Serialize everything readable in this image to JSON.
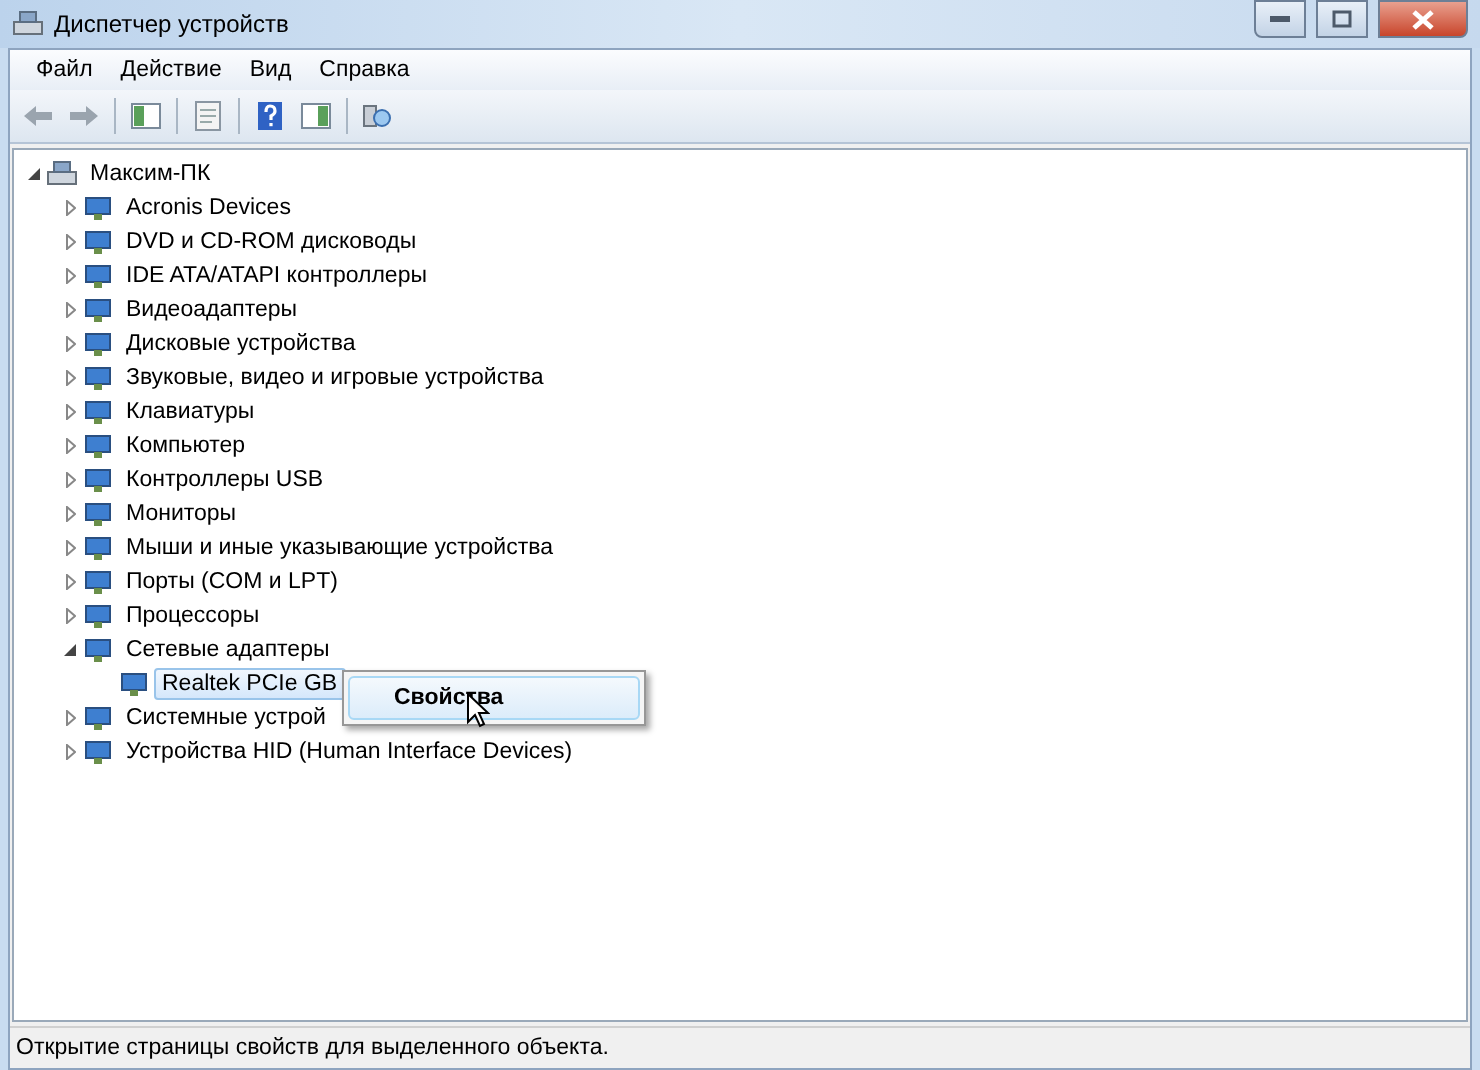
{
  "window": {
    "title": "Диспетчер устройств"
  },
  "menu": [
    "Файл",
    "Действие",
    "Вид",
    "Справка"
  ],
  "tree": {
    "label": "Максим-ПК",
    "expanded": true,
    "selected": false,
    "children": [
      {
        "label": "Acronis Devices",
        "expanded": false,
        "selected": false
      },
      {
        "label": "DVD и CD-ROM дисководы",
        "expanded": false,
        "selected": false
      },
      {
        "label": "IDE ATA/ATAPI контроллеры",
        "expanded": false,
        "selected": false
      },
      {
        "label": "Видеоадаптеры",
        "expanded": false,
        "selected": false
      },
      {
        "label": "Дисковые устройства",
        "expanded": false,
        "selected": false
      },
      {
        "label": "Звуковые, видео и игровые устройства",
        "expanded": false,
        "selected": false
      },
      {
        "label": "Клавиатуры",
        "expanded": false,
        "selected": false
      },
      {
        "label": "Компьютер",
        "expanded": false,
        "selected": false
      },
      {
        "label": "Контроллеры USB",
        "expanded": false,
        "selected": false
      },
      {
        "label": "Мониторы",
        "expanded": false,
        "selected": false
      },
      {
        "label": "Мыши и иные указывающие устройства",
        "expanded": false,
        "selected": false
      },
      {
        "label": "Порты (COM и LPT)",
        "expanded": false,
        "selected": false
      },
      {
        "label": "Процессоры",
        "expanded": false,
        "selected": false
      },
      {
        "label": "Сетевые адаптеры",
        "expanded": true,
        "selected": false,
        "children": [
          {
            "label": "Realtek PCIe GB",
            "selected": true
          }
        ]
      },
      {
        "label": "Системные устрой",
        "expanded": false,
        "selected": false
      },
      {
        "label": "Устройства HID (Human Interface Devices)",
        "expanded": false,
        "selected": false
      }
    ]
  },
  "context_menu": [
    {
      "label": "Свойства",
      "default": true
    }
  ],
  "status_bar": "Открытие страницы свойств для выделенного объекта."
}
